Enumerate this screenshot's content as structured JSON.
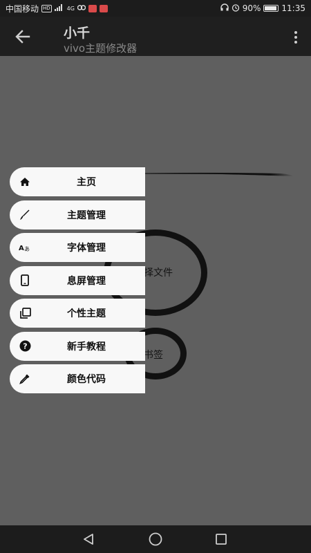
{
  "status_bar": {
    "carrier": "中国移动",
    "hd_badge": "HD",
    "network": "4G",
    "battery_percent": "90%",
    "battery_level": 0.9,
    "time": "11:35"
  },
  "app_bar": {
    "title": "小千",
    "subtitle": "vivo主题修改器"
  },
  "background": {
    "big_button_label": "择文件",
    "small_button_label": "书签"
  },
  "menu": {
    "items": [
      {
        "icon": "home-icon",
        "label": "主页"
      },
      {
        "icon": "brush-icon",
        "label": "主题管理"
      },
      {
        "icon": "font-icon",
        "label": "字体管理"
      },
      {
        "icon": "phone-icon",
        "label": "息屏管理"
      },
      {
        "icon": "layers-icon",
        "label": "个性主题"
      },
      {
        "icon": "help-icon",
        "label": "新手教程"
      },
      {
        "icon": "color-picker-icon",
        "label": "颜色代码"
      }
    ]
  },
  "colors": {
    "background": "#5f5f5f",
    "bars": "#1f1f1f",
    "menu_item": "#f8f8f8"
  }
}
